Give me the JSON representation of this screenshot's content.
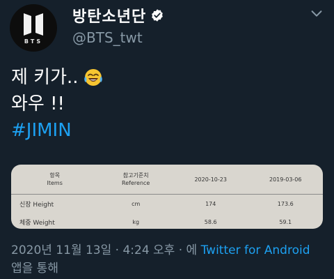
{
  "account": {
    "display_name": "방탄소년단",
    "handle": "@BTS_twt",
    "avatar_text": "BTS"
  },
  "tweet": {
    "line1": "제 키가..",
    "line2": "와우 !!",
    "hashtag": "#JIMIN"
  },
  "media": {
    "header": {
      "item_ko": "항목",
      "item_en": "Items",
      "ref_ko": "참고기준치",
      "ref_en": "Reference",
      "date1": "2020-10-23",
      "date2": "2019-03-06"
    },
    "rows": [
      {
        "item": "신장 Height",
        "ref": "cm",
        "v1": "174",
        "v2": "173.6"
      },
      {
        "item": "체중 Weight",
        "ref": "kg",
        "v1": "58.6",
        "v2": "59.1"
      }
    ]
  },
  "meta": {
    "datetime": "2020년 11월 13일 · 4:24 오후 · 에 ",
    "source": "Twitter for Android",
    "suffix": " 앱을 통해"
  },
  "colors": {
    "background": "#15202b",
    "accent": "#1da1f2",
    "secondary": "#8899a6"
  },
  "icons": [
    "bts-logo-icon",
    "verified-badge-icon",
    "more-options-icon",
    "laughing-tears-emoji"
  ]
}
